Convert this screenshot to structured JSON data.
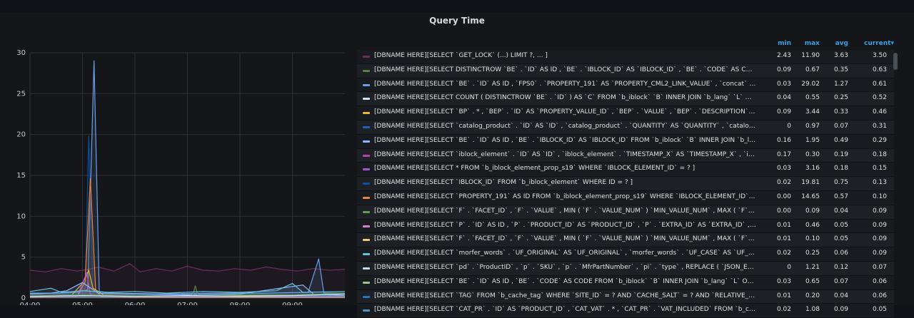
{
  "panel": {
    "title": "Query Time"
  },
  "legend": {
    "headers": {
      "min": "min",
      "max": "max",
      "avg": "avg",
      "current": "current▾"
    },
    "rows": [
      {
        "name": "[DBNAME HERE][SELECT `GET_LOCK` (...) LIMIT ?, ... ]",
        "color": "#6e2d5c",
        "min": "2.43",
        "max": "11.90",
        "avg": "3.63",
        "current": "3.50"
      },
      {
        "name": "[DBNAME HERE][SELECT DISTINCTROW `BE` . `ID` AS ID , `BE` . `IBLOCK_ID` AS `IBLOCK_ID` , `BE` . `CODE` AS CODE , `...",
        "color": "#508642",
        "min": "0.09",
        "max": "0.67",
        "avg": "0.35",
        "current": "0.63"
      },
      {
        "name": "[DBNAME HERE][SELECT `BE` . `ID` AS ID , `FPS0` . `PROPERTY_191` AS `PROPERTY_CML2_LINK_VALUE` , `concat` ( `...",
        "color": "#6d9fe6",
        "min": "0.03",
        "max": "29.02",
        "avg": "1.27",
        "current": "0.61"
      },
      {
        "name": "[DBNAME HERE][SELECT COUNT ( DISTINCTROW `BE` . `ID` ) AS `C` FROM `b_iblock` `B` INNER JOIN `b_lang` `L` ON `B...",
        "color": "#cce6ff",
        "min": "0.04",
        "max": "0.55",
        "avg": "0.25",
        "current": "0.52"
      },
      {
        "name": "[DBNAME HERE][SELECT `BP` . * , `BEP` . `ID` AS `PROPERTY_VALUE_ID` , `BEP` . `VALUE` , `BEP` . `DESCRIPTION` , `BE...",
        "color": "#eab839",
        "min": "0.09",
        "max": "3.44",
        "avg": "0.33",
        "current": "0.46"
      },
      {
        "name": "[DBNAME HERE][SELECT `catalog_product` . `ID` AS `ID` , `catalog_product` . `QUANTITY` AS `QUANTITY` , `catalog_pr...",
        "color": "#1f60c4",
        "min": "0",
        "max": "0.97",
        "avg": "0.07",
        "current": "0.31"
      },
      {
        "name": "[DBNAME HERE][SELECT `BE` . `ID` AS ID , `BE` . `IBLOCK_ID` AS `IBLOCK_ID` FROM `b_iblock` `B` INNER JOIN `b_lang` ...",
        "color": "#8ab8ff",
        "min": "0.16",
        "max": "1.95",
        "avg": "0.49",
        "current": "0.29"
      },
      {
        "name": "[DBNAME HERE][SELECT `iblock_element` . `ID` AS `ID` , `iblock_element` . `TIMESTAMP_X` AS `TIMESTAMP_X` , `iblo...",
        "color": "#ba43a9",
        "min": "0.17",
        "max": "0.30",
        "avg": "0.19",
        "current": "0.18"
      },
      {
        "name": "[DBNAME HERE][SELECT * FROM `b_iblock_element_prop_s19` WHERE `IBLOCK_ELEMENT_ID` = ? ]",
        "color": "#a352cc",
        "min": "0.03",
        "max": "3.16",
        "avg": "0.18",
        "current": "0.15"
      },
      {
        "name": "[DBNAME HERE][SELECT `IBLOCK_ID` FROM `b_iblock_element` WHERE ID = ? ]",
        "color": "#0a50a1",
        "min": "0.02",
        "max": "19.81",
        "avg": "0.75",
        "current": "0.13"
      },
      {
        "name": "[DBNAME HERE][SELECT `PROPERTY_191` AS ID FROM `b_iblock_element_prop_s19` WHERE `IBLOCK_ELEMENT_ID` ...",
        "color": "#ef843c",
        "min": "0.00",
        "max": "14.65",
        "avg": "0.57",
        "current": "0.10"
      },
      {
        "name": "[DBNAME HERE][SELECT `F` . `FACET_ID` , `F` . `VALUE` , MIN ( `F` . `VALUE_NUM` ) `MIN_VALUE_NUM` , MAX ( `F` . `V...",
        "color": "#629e51",
        "min": "0.00",
        "max": "0.09",
        "avg": "0.04",
        "current": "0.09"
      },
      {
        "name": "[DBNAME HERE][SELECT `P` . `ID` AS ID , `P` . `PRODUCT_ID` AS `PRODUCT_ID` , `P` . `EXTRA_ID` AS `EXTRA_ID` , `P` . `...",
        "color": "#d683ce",
        "min": "0.01",
        "max": "0.46",
        "avg": "0.05",
        "current": "0.09"
      },
      {
        "name": "[DBNAME HERE][SELECT `F` . `FACET_ID` , `F` . `VALUE` , MIN ( `F` . `VALUE_NUM` ) `MIN_VALUE_NUM` , MAX ( `F` . `V...",
        "color": "#f2c96d",
        "min": "0.01",
        "max": "0.10",
        "avg": "0.05",
        "current": "0.09"
      },
      {
        "name": "[DBNAME HERE][SELECT `morfer_words` . `UF_ORIGINAL` AS `UF_ORIGINAL` , `morfer_words` . `UF_CASE` AS `UF_CA...",
        "color": "#65c5db",
        "min": "0.02",
        "max": "0.25",
        "avg": "0.06",
        "current": "0.09"
      },
      {
        "name": "[DBNAME HERE][SELECT `pd` . `ProductID` , `p` . `SKU` , `p` . `MfrPartNumber` , `pi` . `type` , REPLACE ( `JSON_EXTRAC...",
        "color": "#badff4",
        "min": "0",
        "max": "1.21",
        "avg": "0.12",
        "current": "0.07"
      },
      {
        "name": "[DBNAME HERE][SELECT `BE` . `ID` AS ID , `BE` . `CODE` AS CODE FROM `b_iblock` `B` INNER JOIN `b_lang` `L` ON `B` . ...",
        "color": "#9ac48a",
        "min": "0.03",
        "max": "0.65",
        "avg": "0.07",
        "current": "0.06"
      },
      {
        "name": "[DBNAME HERE][SELECT `TAG` FROM `b_cache_tag` WHERE `SITE_ID` = ? AND `CACHE_SALT` = ? AND `RELATIVE_PA...",
        "color": "#1f78c1",
        "min": "0.01",
        "max": "0.20",
        "avg": "0.04",
        "current": "0.06"
      },
      {
        "name": "[DBNAME HERE][SELECT `CAT_PR` . `ID` AS `PRODUCT_ID` , `CAT_VAT` . * , `CAT_PR` . `VAT_INCLUDED` FROM `b_catal...",
        "color": "#5195ce",
        "min": "0.02",
        "max": "1.08",
        "avg": "0.09",
        "current": "0.05"
      }
    ]
  },
  "chart_data": {
    "type": "line",
    "title": "Query Time",
    "xlabel": "",
    "ylabel": "",
    "ylim": [
      0,
      30
    ],
    "xlim": [
      "04:00",
      "10:00"
    ],
    "yticks": [
      0,
      5,
      10,
      15,
      20,
      25,
      30
    ],
    "xticks": [
      "04:00",
      "05:00",
      "06:00",
      "07:00",
      "08:00",
      "09:00"
    ],
    "grid": true,
    "legend_position": "right",
    "series": [
      {
        "color": "#6e2d5c",
        "points": [
          [
            4.0,
            3.4
          ],
          [
            4.3,
            3.2
          ],
          [
            4.6,
            3.6
          ],
          [
            4.9,
            3.3
          ],
          [
            5.1,
            3.5
          ],
          [
            5.3,
            3.8
          ],
          [
            5.6,
            3.3
          ],
          [
            5.9,
            4.2
          ],
          [
            6.1,
            3.2
          ],
          [
            6.4,
            3.6
          ],
          [
            6.7,
            3.3
          ],
          [
            7.0,
            3.9
          ],
          [
            7.3,
            3.4
          ],
          [
            7.6,
            3.3
          ],
          [
            7.9,
            3.6
          ],
          [
            8.2,
            3.4
          ],
          [
            8.5,
            3.8
          ],
          [
            8.8,
            3.5
          ],
          [
            9.1,
            3.3
          ],
          [
            9.4,
            3.6
          ],
          [
            9.7,
            3.4
          ],
          [
            10.0,
            3.5
          ]
        ]
      },
      {
        "color": "#6d9fe6",
        "points": [
          [
            4.0,
            0.6
          ],
          [
            4.6,
            0.6
          ],
          [
            4.9,
            0.7
          ],
          [
            5.1,
            1.0
          ],
          [
            5.22,
            29.0
          ],
          [
            5.32,
            0.8
          ],
          [
            5.6,
            0.6
          ],
          [
            6.5,
            0.5
          ],
          [
            7.5,
            0.6
          ],
          [
            8.5,
            0.6
          ],
          [
            9.3,
            0.7
          ],
          [
            9.5,
            4.8
          ],
          [
            9.6,
            0.6
          ],
          [
            10.0,
            0.6
          ]
        ]
      },
      {
        "color": "#0a50a1",
        "points": [
          [
            4.0,
            0.3
          ],
          [
            4.9,
            0.4
          ],
          [
            5.05,
            1.2
          ],
          [
            5.12,
            19.8
          ],
          [
            5.2,
            1.0
          ],
          [
            5.35,
            0.4
          ],
          [
            6.0,
            0.3
          ],
          [
            7.0,
            0.3
          ],
          [
            8.0,
            0.3
          ],
          [
            9.0,
            0.3
          ],
          [
            10.0,
            0.3
          ]
        ]
      },
      {
        "color": "#ef843c",
        "points": [
          [
            4.0,
            0.1
          ],
          [
            4.9,
            0.2
          ],
          [
            5.05,
            2.0
          ],
          [
            5.15,
            14.6
          ],
          [
            5.25,
            1.0
          ],
          [
            5.35,
            0.2
          ],
          [
            6.0,
            0.1
          ],
          [
            7.0,
            0.1
          ],
          [
            8.0,
            0.1
          ],
          [
            9.0,
            0.1
          ],
          [
            10.0,
            0.1
          ]
        ]
      },
      {
        "color": "#eab839",
        "points": [
          [
            4.0,
            0.3
          ],
          [
            4.8,
            0.4
          ],
          [
            5.0,
            1.8
          ],
          [
            5.12,
            3.4
          ],
          [
            5.2,
            1.2
          ],
          [
            5.4,
            0.4
          ],
          [
            6.0,
            0.3
          ],
          [
            7.0,
            0.3
          ],
          [
            8.0,
            0.3
          ],
          [
            9.0,
            0.3
          ],
          [
            10.0,
            0.5
          ]
        ]
      },
      {
        "color": "#a352cc",
        "points": [
          [
            4.0,
            0.2
          ],
          [
            4.9,
            0.2
          ],
          [
            5.08,
            3.1
          ],
          [
            5.15,
            0.5
          ],
          [
            5.4,
            0.2
          ],
          [
            6.5,
            0.2
          ],
          [
            8.0,
            0.2
          ],
          [
            10.0,
            0.2
          ]
        ]
      },
      {
        "color": "#8ab8ff",
        "points": [
          [
            4.0,
            0.5
          ],
          [
            4.4,
            0.6
          ],
          [
            4.7,
            0.9
          ],
          [
            5.0,
            1.9
          ],
          [
            5.3,
            0.6
          ],
          [
            6.0,
            0.5
          ],
          [
            7.0,
            0.4
          ],
          [
            8.0,
            0.5
          ],
          [
            9.2,
            1.6
          ],
          [
            9.4,
            0.5
          ],
          [
            10.0,
            0.3
          ]
        ]
      },
      {
        "color": "#508642",
        "points": [
          [
            4.0,
            0.3
          ],
          [
            5.0,
            0.4
          ],
          [
            6.0,
            0.3
          ],
          [
            7.1,
            0.3
          ],
          [
            7.15,
            1.5
          ],
          [
            7.2,
            0.3
          ],
          [
            8.0,
            0.4
          ],
          [
            9.0,
            0.4
          ],
          [
            10.0,
            0.6
          ]
        ]
      },
      {
        "color": "#65c5db",
        "points": [
          [
            4.0,
            0.8
          ],
          [
            4.4,
            1.2
          ],
          [
            4.6,
            0.7
          ],
          [
            5.0,
            0.9
          ],
          [
            5.5,
            0.7
          ],
          [
            6.0,
            0.8
          ],
          [
            6.6,
            0.6
          ],
          [
            7.3,
            0.8
          ],
          [
            8.0,
            0.7
          ],
          [
            8.7,
            0.9
          ],
          [
            9.0,
            1.8
          ],
          [
            9.2,
            0.7
          ],
          [
            10.0,
            0.8
          ]
        ]
      },
      {
        "color": "#cce6ff",
        "points": [
          [
            4.0,
            0.2
          ],
          [
            5.0,
            0.3
          ],
          [
            6.0,
            0.2
          ],
          [
            7.0,
            0.3
          ],
          [
            8.0,
            0.2
          ],
          [
            9.0,
            0.3
          ],
          [
            10.0,
            0.5
          ]
        ]
      }
    ]
  }
}
